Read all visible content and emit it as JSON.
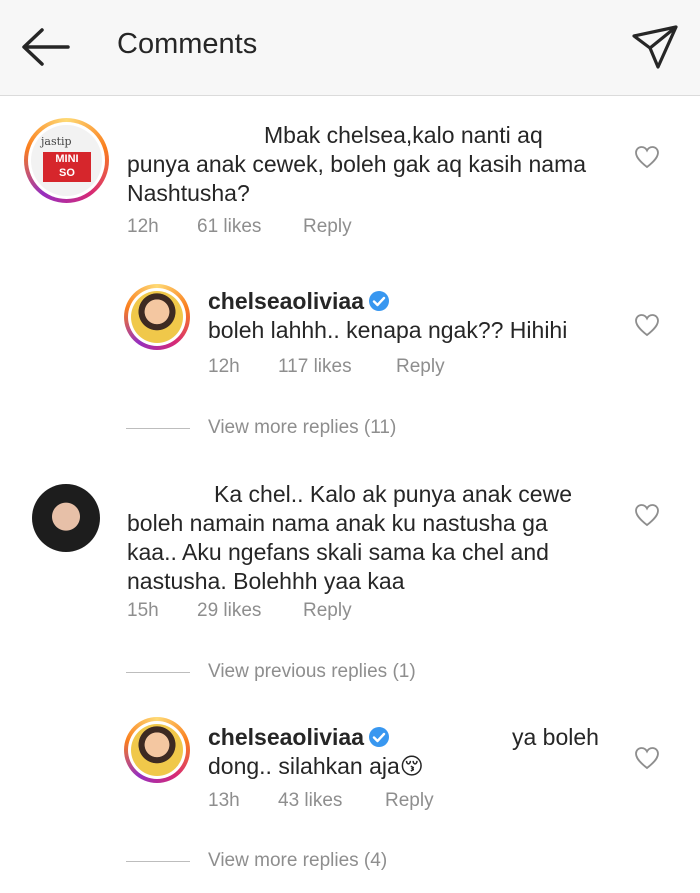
{
  "header": {
    "title": "Comments",
    "back_icon": "back-arrow-icon",
    "send_icon": "paper-plane-icon"
  },
  "avatars": {
    "jastip": {
      "line1": "jastip",
      "line2": "MINI",
      "line3": "SO"
    }
  },
  "comments": [
    {
      "text": "Mbak chelsea,kalo nanti aq punya anak cewek, boleh gak aq kasih nama Nashtusha?",
      "line1": "Mbak chelsea,kalo nanti aq",
      "line2": "punya anak cewek, boleh gak aq kasih nama",
      "line3": "Nashtusha?",
      "time": "12h",
      "likes": "61 likes",
      "reply": "Reply",
      "reply_block": {
        "username": "chelseaoliviaa",
        "text": "boleh lahhh.. kenapa ngak?? Hihihi",
        "time": "12h",
        "likes": "117 likes",
        "reply": "Reply"
      },
      "more": "View more replies (11)"
    },
    {
      "line1": "Ka chel.. Kalo ak punya anak cewe",
      "line2": "boleh namain nama anak ku nastusha ga",
      "line3": "kaa.. Aku ngefans skali sama ka chel and",
      "line4": "nastusha. Bolehhh yaa kaa",
      "time": "15h",
      "likes": "29 likes",
      "reply": "Reply",
      "previous": "View previous replies (1)",
      "reply_block": {
        "username": "chelseaoliviaa",
        "text_line1": "ya boleh",
        "text_line2": "dong.. silahkan aja😚",
        "time": "13h",
        "likes": "43 likes",
        "reply": "Reply"
      },
      "more": "View more replies (4)"
    }
  ],
  "icons": {
    "heart": "heart-outline-icon",
    "verified": "verified-badge-icon"
  },
  "colors": {
    "verified": "#3897f0",
    "meta": "#8e8e8e",
    "text": "#262626"
  }
}
